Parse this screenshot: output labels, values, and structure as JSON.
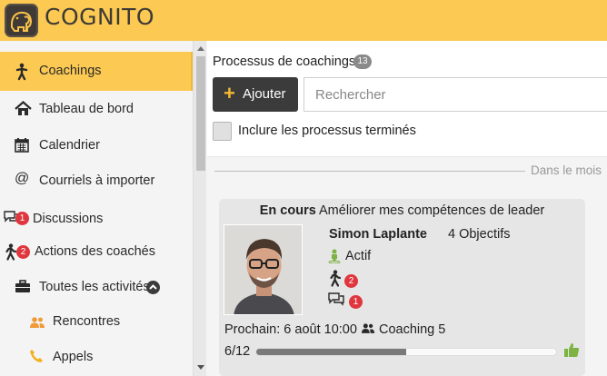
{
  "app": {
    "name": "COGNITO"
  },
  "colors": {
    "brand": "#fcc952",
    "badge": "#e0363d",
    "dark_button": "#3b3b3b",
    "status_green": "#7cb342"
  },
  "sidebar": {
    "items": [
      {
        "label": "Coachings",
        "icon": "walking-person-icon",
        "active": true
      },
      {
        "label": "Tableau de bord",
        "icon": "home-icon"
      },
      {
        "label": "Calendrier",
        "icon": "calendar-icon"
      },
      {
        "label": "Courriels à importer",
        "icon": "at-sign-icon"
      },
      {
        "label": "Discussions",
        "icon": "comments-icon",
        "badge": "1"
      },
      {
        "label": "Actions des coachés",
        "icon": "walking-person-icon",
        "badge": "2"
      },
      {
        "label": "Toutes les activités",
        "icon": "briefcase-icon",
        "expanded": true
      },
      {
        "label": "Rencontres",
        "icon": "users-icon"
      },
      {
        "label": "Appels",
        "icon": "phone-icon"
      }
    ]
  },
  "main": {
    "title": "Processus de coachings",
    "count": "13",
    "add_button": "Ajouter",
    "search_placeholder": "Rechercher",
    "include_finished_label": "Inclure les processus terminés",
    "divider_label": "Dans le mois"
  },
  "card": {
    "status": "En cours",
    "goal": "Améliorer mes compétences de leader",
    "coach_name": "Simon Laplante",
    "objectives": "4 Objectifs",
    "state": "Actif",
    "actions_badge": "2",
    "discussions_badge": "1",
    "next_label": "Prochain: 6 août 10:00",
    "session_label": "Coaching 5",
    "progress_label": "6/12",
    "progress_fraction": 0.5
  }
}
